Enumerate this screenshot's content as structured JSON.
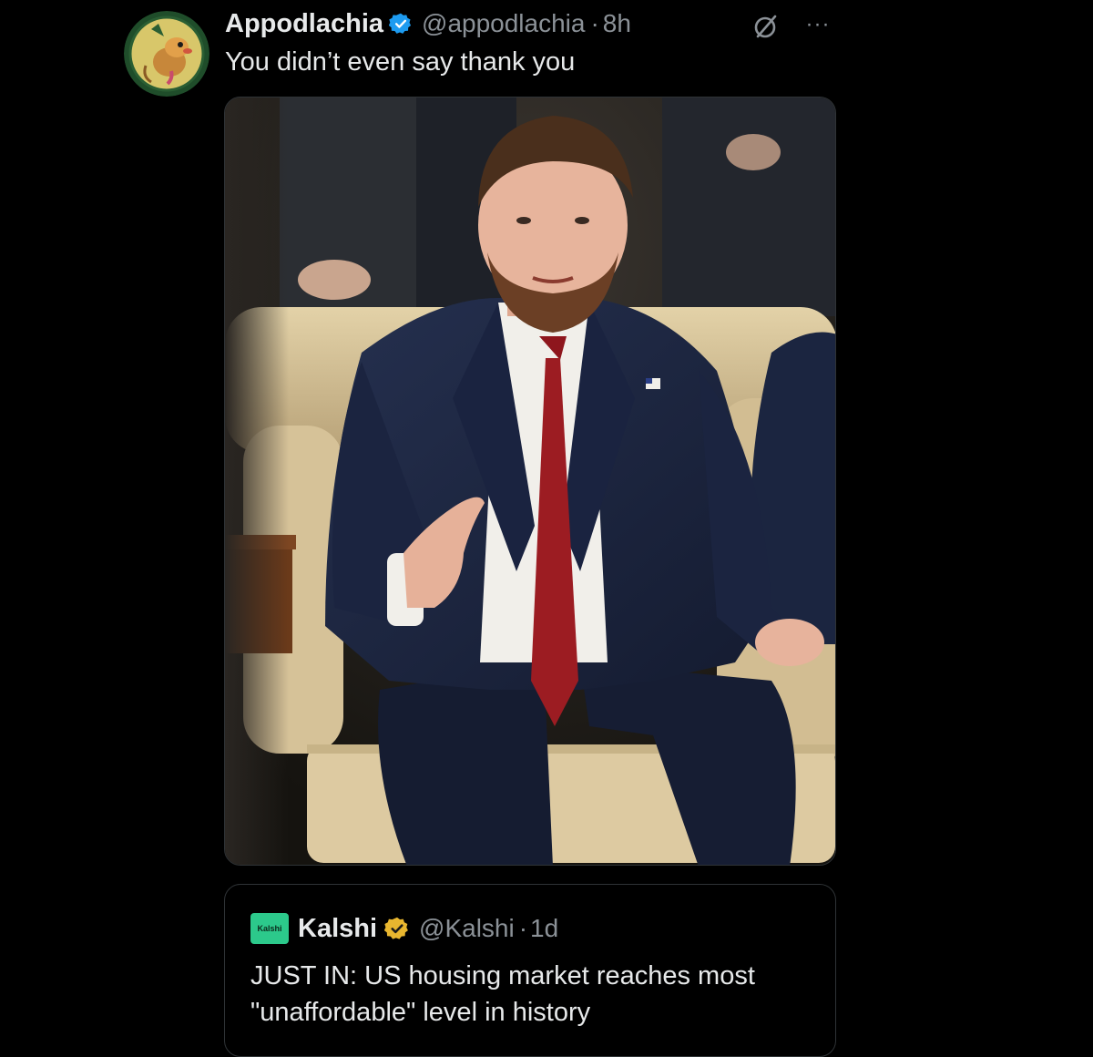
{
  "post": {
    "display_name": "Appodlachia",
    "handle": "@appodlachia",
    "separator": "·",
    "time": "8h",
    "text": "You didn’t even say thank you",
    "more_label": "···",
    "avatar_icon": "possum-cartoon-avatar",
    "verified_icon": "verified-badge-blue",
    "verified_color": "#1d9bf0"
  },
  "media": {
    "description_icon": "photo-man-in-suit-seated-on-couch",
    "colors": {
      "suit": "#1c2540",
      "tie": "#9c1c22",
      "shirt": "#f1efea",
      "couch": "#d8c49a"
    }
  },
  "quote": {
    "avatar_text": "Kalshi",
    "avatar_color": "#2cc98b",
    "display_name": "Kalshi",
    "handle": "@Kalshi",
    "separator": "·",
    "time": "1d",
    "text": "JUST IN: US housing market reaches most \"unaffordable\" level in history",
    "verified_icon": "verified-badge-gold",
    "verified_color": "#e8b62f"
  },
  "theme": {
    "background": "#000000",
    "text_primary": "#e7e9ea",
    "text_secondary": "#8b9197",
    "border": "#2f3336"
  }
}
